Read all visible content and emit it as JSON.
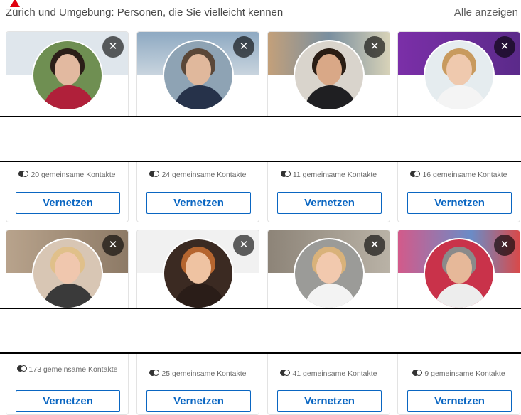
{
  "header": {
    "title": "Zürich und Umgebung: Personen, die Sie vielleicht kennen",
    "see_all": "Alle anzeigen"
  },
  "colors": {
    "accent": "#0a66c2",
    "warning": "#e0000f"
  },
  "icons": {
    "dismiss": "close-icon",
    "mutual": "connections-icon"
  },
  "row1": [
    {
      "mutual": "20 gemeinsame Kontakte",
      "connect": "Vernetzen",
      "dismiss": "✕"
    },
    {
      "mutual": "24 gemeinsame Kontakte",
      "connect": "Vernetzen",
      "dismiss": "✕"
    },
    {
      "mutual": "11 gemeinsame Kontakte",
      "connect": "Vernetzen",
      "dismiss": "✕"
    },
    {
      "mutual": "16 gemeinsame Kontakte",
      "connect": "Vernetzen",
      "dismiss": "✕"
    }
  ],
  "row2": [
    {
      "mutual": "173 gemeinsame Kontakte",
      "connect": "Vernetzen",
      "dismiss": "✕"
    },
    {
      "mutual": "25 gemeinsame Kontakte",
      "connect": "Vernetzen",
      "dismiss": "✕"
    },
    {
      "mutual": "41 gemeinsame Kontakte",
      "connect": "Vernetzen",
      "dismiss": "✕"
    },
    {
      "mutual": "9 gemeinsame Kontakte",
      "connect": "Vernetzen",
      "dismiss": "✕"
    }
  ]
}
